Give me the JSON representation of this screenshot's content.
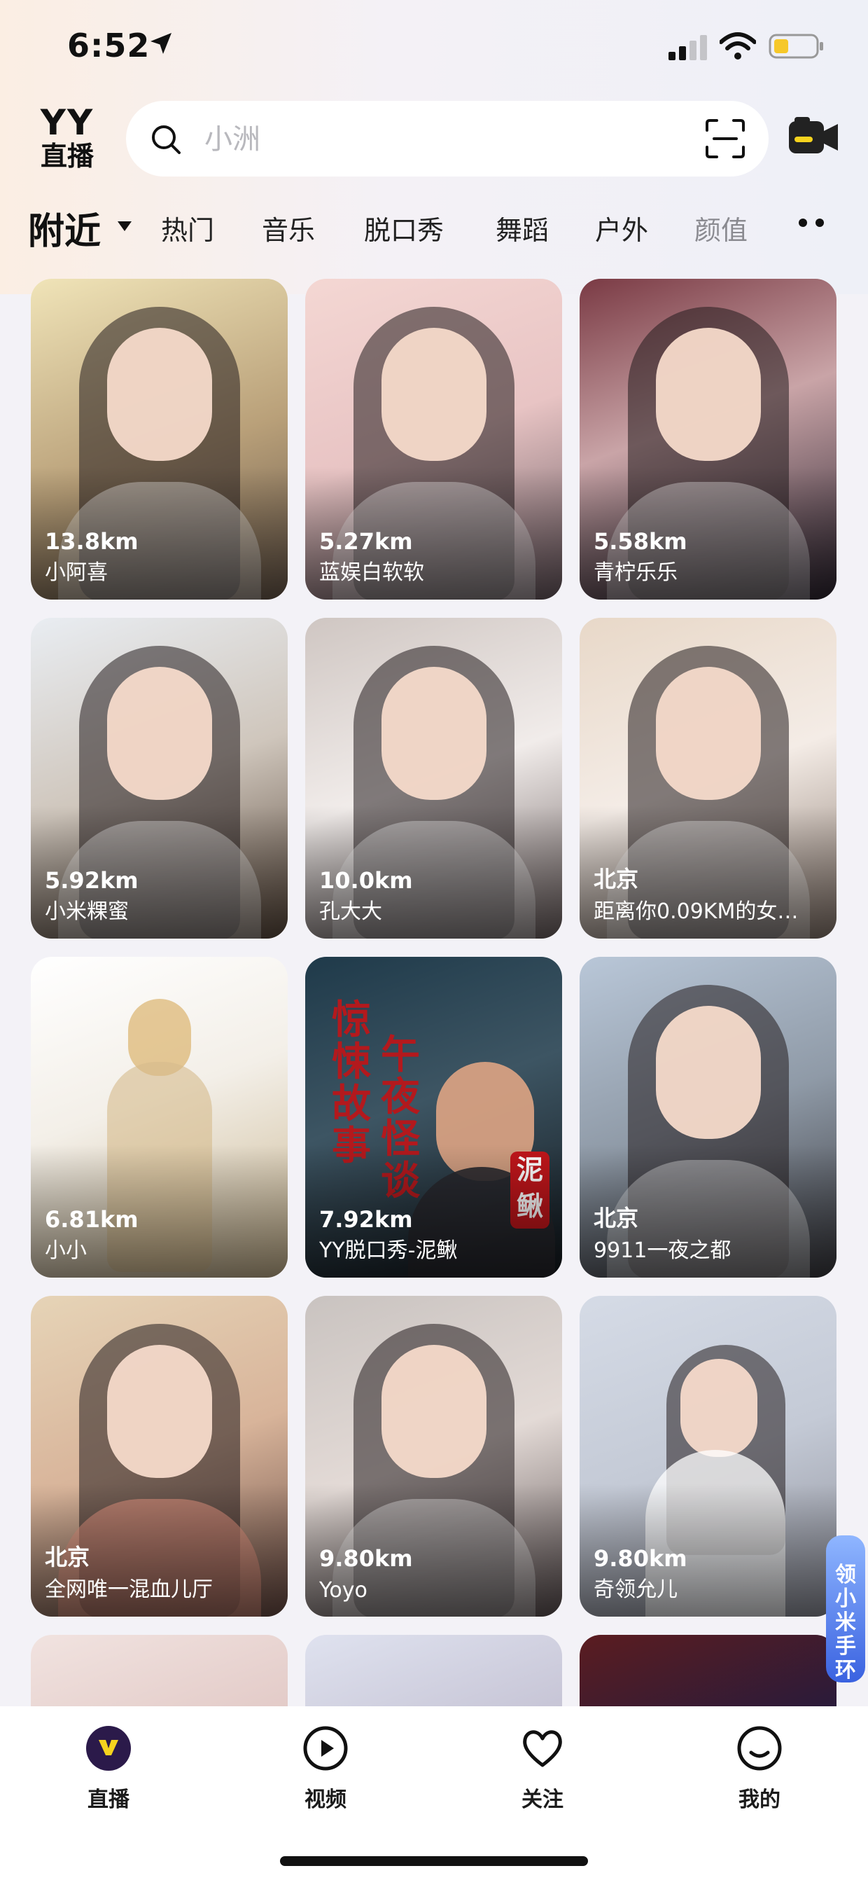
{
  "status_bar": {
    "time": "6:52"
  },
  "header": {
    "logo_line1": "YY",
    "logo_line2": "直播",
    "search_placeholder": "小洲"
  },
  "tabs": [
    {
      "label": "附近",
      "active": true
    },
    {
      "label": "热门"
    },
    {
      "label": "音乐"
    },
    {
      "label": "脱口秀"
    },
    {
      "label": "舞蹈"
    },
    {
      "label": "户外"
    },
    {
      "label": "颜值"
    }
  ],
  "cards": [
    {
      "distance": "13.8km",
      "name": "小阿喜",
      "bg": "linear-gradient(160deg,#f0e4b8 0%,#b9a079 55%,#6b5a4c 100%)"
    },
    {
      "distance": "5.27km",
      "name": "蓝娱白软软",
      "bg": "linear-gradient(160deg,#f4d7d3 0%,#e8c4c4 50%,#6b5b62 100%)"
    },
    {
      "distance": "5.58km",
      "name": "青柠乐乐",
      "bg": "linear-gradient(160deg,#7a3a44 0%,#c9a4a7 45%,#2c2430 100%)"
    },
    {
      "distance": "5.92km",
      "name": "小米粿蜜",
      "bg": "linear-gradient(160deg,#e9edf2 0%,#cfc6bc 50%,#5c4b3e 100%)"
    },
    {
      "distance": "10.0km",
      "name": "孔大大",
      "bg": "linear-gradient(160deg,#cfc6c2 0%,#f1ecea 50%,#6e6262 100%)"
    },
    {
      "distance": "北京",
      "name": "距离你0.09KM的女…",
      "bg": "linear-gradient(160deg,#e8d8c8 0%,#f4ece6 50%,#8a7a70 100%)"
    },
    {
      "distance": "6.81km",
      "name": "小小",
      "bg": "linear-gradient(160deg,#ffffff 0%,#f3efe8 45%,#c9b58f 100%)"
    },
    {
      "distance": "7.92km",
      "name": "YY脱口秀-泥鳅",
      "bg": "linear-gradient(160deg,#1f3a4a 0%,#3d5563 45%,#12171c 100%)",
      "calli1": "惊悚故事",
      "calli2": "午夜怪谈",
      "seal": "泥鳅"
    },
    {
      "distance": "北京",
      "name": "9911一夜之都",
      "bg": "linear-gradient(160deg,#b9c7d8 0%,#8f9aa7 50%,#3a3a3f 100%)"
    },
    {
      "distance": "北京",
      "name": "全网唯一混血儿厅",
      "bg": "linear-gradient(160deg,#e6d4b7 0%,#d8b49a 50%,#6a4c44 100%)"
    },
    {
      "distance": "9.80km",
      "name": "Yoyo",
      "bg": "linear-gradient(160deg,#c9c3c0 0%,#e3dad6 50%,#5d5253 100%)"
    },
    {
      "distance": "9.80km",
      "name": "奇领允儿",
      "bg": "linear-gradient(160deg,#d5dbe6 0%,#c4cad6 50%,#8d8f99 100%)"
    },
    {
      "distance": "",
      "name": "",
      "bg": "linear-gradient(160deg,#f1e3e0 0%,#e3cbc8 100%)"
    },
    {
      "distance": "",
      "name": "",
      "bg": "linear-gradient(160deg,#dfe2ef 0%,#c7c5d6 100%)"
    },
    {
      "distance": "",
      "name": "",
      "bg": "linear-gradient(160deg,#5b1c20 0%,#2a1b3a 100%)"
    }
  ],
  "badge": {
    "text": "领小米手环"
  },
  "bottom_nav": [
    {
      "label": "直播",
      "active": true
    },
    {
      "label": "视频"
    },
    {
      "label": "关注"
    },
    {
      "label": "我的"
    }
  ],
  "colors": {
    "accent": "#f6d31e",
    "text": "#111111",
    "seal_red": "#c0161b"
  }
}
